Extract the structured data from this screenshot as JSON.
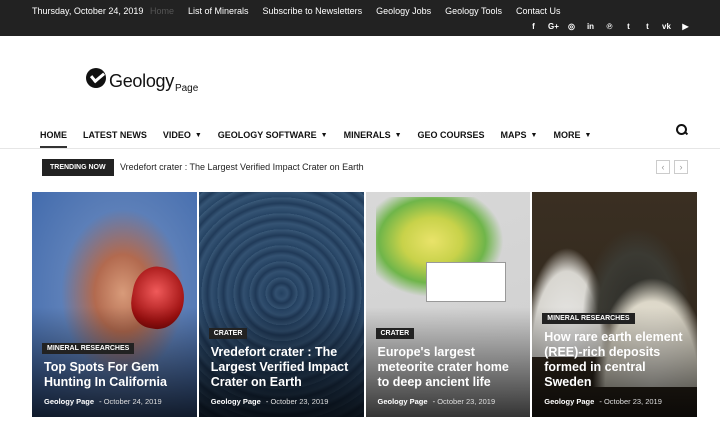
{
  "topbar": {
    "date": "Thursday, October 24, 2019",
    "nav": [
      "Home",
      "List of Minerals",
      "Subscribe to Newsletters",
      "Geology Jobs",
      "Geology Tools",
      "Contact Us"
    ],
    "social": [
      "f",
      "G+",
      "◎",
      "in",
      "℗",
      "t",
      "t",
      "vk",
      "▶"
    ]
  },
  "logo": {
    "word": "Geology",
    "sub": "Page"
  },
  "mainnav": [
    "HOME",
    "LATEST NEWS",
    "VIDEO",
    "GEOLOGY SOFTWARE",
    "MINERALS",
    "GEO COURSES",
    "MAPS",
    "MORE"
  ],
  "trending": {
    "label": "TRENDING NOW",
    "title": "Vredefort crater : The Largest Verified Impact Crater on Earth"
  },
  "cards": [
    {
      "category": "MINERAL RESEARCHES",
      "title": "Top Spots For Gem Hunting In California",
      "author": "Geology Page",
      "date": "October 24, 2019"
    },
    {
      "category": "CRATER",
      "title": "Vredefort crater : The Largest Verified Impact Crater on Earth",
      "author": "Geology Page",
      "date": "October 23, 2019"
    },
    {
      "category": "CRATER",
      "title": "Europe's largest meteorite crater home to deep ancient life",
      "author": "Geology Page",
      "date": "October 23, 2019"
    },
    {
      "category": "MINERAL RESEARCHES",
      "title": "How rare earth element (REE)-rich deposits formed in central Sweden",
      "author": "Geology Page",
      "date": "October 23, 2019"
    }
  ]
}
